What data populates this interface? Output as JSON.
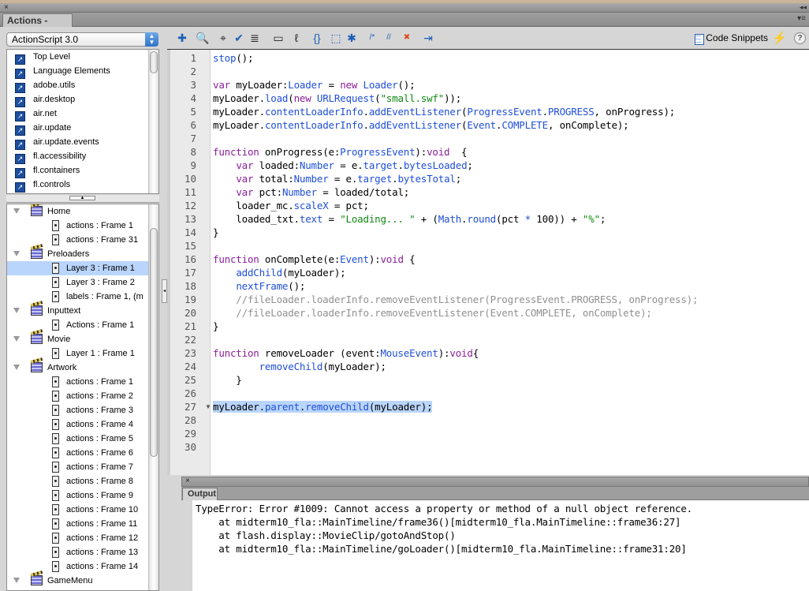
{
  "window": {
    "close": "×",
    "collapse": "◂◂",
    "panel_menu": "▾≡",
    "tab": "Actions - Frame"
  },
  "language_select": {
    "value": "ActionScript 3.0"
  },
  "library": {
    "items": [
      "Top Level",
      "Language Elements",
      "adobe.utils",
      "air.desktop",
      "air.net",
      "air.update",
      "air.update.events",
      "fl.accessibility",
      "fl.containers",
      "fl.controls"
    ]
  },
  "tree": {
    "rows": [
      {
        "type": "group",
        "label": "Home"
      },
      {
        "type": "frame",
        "label": "actions : Frame 1"
      },
      {
        "type": "frame",
        "label": "actions : Frame 31"
      },
      {
        "type": "group",
        "label": "Preloaders"
      },
      {
        "type": "frame",
        "label": "Layer 3 : Frame 1",
        "selected": true
      },
      {
        "type": "frame",
        "label": "Layer 3 : Frame 2"
      },
      {
        "type": "frame",
        "label": "labels : Frame 1, (m"
      },
      {
        "type": "group",
        "label": "Inputtext"
      },
      {
        "type": "frame",
        "label": "Actions : Frame 1"
      },
      {
        "type": "group",
        "label": "Movie"
      },
      {
        "type": "frame",
        "label": "Layer 1 : Frame 1"
      },
      {
        "type": "group",
        "label": "Artwork"
      },
      {
        "type": "frame",
        "label": "actions : Frame 1"
      },
      {
        "type": "frame",
        "label": "actions : Frame 2"
      },
      {
        "type": "frame",
        "label": "actions : Frame 3"
      },
      {
        "type": "frame",
        "label": "actions : Frame 4"
      },
      {
        "type": "frame",
        "label": "actions : Frame 5"
      },
      {
        "type": "frame",
        "label": "actions : Frame 6"
      },
      {
        "type": "frame",
        "label": "actions : Frame 7"
      },
      {
        "type": "frame",
        "label": "actions : Frame 8"
      },
      {
        "type": "frame",
        "label": "actions : Frame 9"
      },
      {
        "type": "frame",
        "label": "actions : Frame 10"
      },
      {
        "type": "frame",
        "label": "actions : Frame 11"
      },
      {
        "type": "frame",
        "label": "actions : Frame 12"
      },
      {
        "type": "frame",
        "label": "actions : Frame 13"
      },
      {
        "type": "frame",
        "label": "actions : Frame 14"
      },
      {
        "type": "group",
        "label": "GameMenu"
      }
    ]
  },
  "toolbar": {
    "icons": [
      {
        "name": "add-statement-icon",
        "glyph": "✚"
      },
      {
        "name": "find-icon",
        "glyph": "🔍"
      },
      {
        "name": "target-path-icon",
        "glyph": "⌖"
      },
      {
        "name": "check-syntax-icon",
        "glyph": "✔"
      },
      {
        "name": "auto-format-icon",
        "glyph": "≣"
      },
      {
        "name": "code-hint-icon",
        "glyph": "▭"
      },
      {
        "name": "debug-options-icon",
        "glyph": "ℓ"
      },
      {
        "name": "collapse-braces-icon",
        "glyph": "{}"
      },
      {
        "name": "collapse-selection-icon",
        "glyph": "⬚"
      },
      {
        "name": "expand-all-icon",
        "glyph": "✱"
      },
      {
        "name": "block-comment-icon",
        "glyph": "/*"
      },
      {
        "name": "line-comment-icon",
        "glyph": "//"
      },
      {
        "name": "remove-comment-icon",
        "glyph": "✖"
      },
      {
        "name": "show-hide-toolbox-icon",
        "glyph": "⇥"
      }
    ],
    "code_snippets": "Code Snippets",
    "wand": "⚡",
    "help": "?"
  },
  "code": {
    "selected_line": 27,
    "lines": [
      [
        [
          "stop",
          "ty"
        ],
        [
          "();",
          "pl"
        ]
      ],
      [],
      [
        [
          "var",
          "kw"
        ],
        [
          " myLoader:",
          "pl"
        ],
        [
          "Loader",
          "ty"
        ],
        [
          " = ",
          "pl"
        ],
        [
          "new",
          "kw"
        ],
        [
          " ",
          "pl"
        ],
        [
          "Loader",
          "ty"
        ],
        [
          "();",
          "pl"
        ]
      ],
      [
        [
          "myLoader.",
          "pl"
        ],
        [
          "load",
          "ty"
        ],
        [
          "(",
          "pl"
        ],
        [
          "new",
          "kw"
        ],
        [
          " ",
          "pl"
        ],
        [
          "URLRequest",
          "ty"
        ],
        [
          "(",
          "pl"
        ],
        [
          "\"small.swf\"",
          "str"
        ],
        [
          "));",
          "pl"
        ]
      ],
      [
        [
          "myLoader.",
          "pl"
        ],
        [
          "contentLoaderInfo",
          "ty"
        ],
        [
          ".",
          "pl"
        ],
        [
          "addEventListener",
          "ty"
        ],
        [
          "(",
          "pl"
        ],
        [
          "ProgressEvent",
          "ty"
        ],
        [
          ".",
          "pl"
        ],
        [
          "PROGRESS",
          "ty"
        ],
        [
          ", onProgress);",
          "pl"
        ]
      ],
      [
        [
          "myLoader.",
          "pl"
        ],
        [
          "contentLoaderInfo",
          "ty"
        ],
        [
          ".",
          "pl"
        ],
        [
          "addEventListener",
          "ty"
        ],
        [
          "(",
          "pl"
        ],
        [
          "Event",
          "ty"
        ],
        [
          ".",
          "pl"
        ],
        [
          "COMPLETE",
          "ty"
        ],
        [
          ", onComplete);",
          "pl"
        ]
      ],
      [],
      [
        [
          "function",
          "kw"
        ],
        [
          " onProgress(e:",
          "pl"
        ],
        [
          "ProgressEvent",
          "ty"
        ],
        [
          "):",
          "pl"
        ],
        [
          "void",
          "kw"
        ],
        [
          "  {",
          "pl"
        ]
      ],
      [
        [
          "    ",
          "pl"
        ],
        [
          "var",
          "kw"
        ],
        [
          " loaded:",
          "pl"
        ],
        [
          "Number",
          "ty"
        ],
        [
          " = e.",
          "pl"
        ],
        [
          "target",
          "ty"
        ],
        [
          ".",
          "pl"
        ],
        [
          "bytesLoaded",
          "ty"
        ],
        [
          ";",
          "pl"
        ]
      ],
      [
        [
          "    ",
          "pl"
        ],
        [
          "var",
          "kw"
        ],
        [
          " total:",
          "pl"
        ],
        [
          "Number",
          "ty"
        ],
        [
          " = e.",
          "pl"
        ],
        [
          "target",
          "ty"
        ],
        [
          ".",
          "pl"
        ],
        [
          "bytesTotal",
          "ty"
        ],
        [
          ";",
          "pl"
        ]
      ],
      [
        [
          "    ",
          "pl"
        ],
        [
          "var",
          "kw"
        ],
        [
          " pct:",
          "pl"
        ],
        [
          "Number",
          "ty"
        ],
        [
          " = loaded/total;",
          "pl"
        ]
      ],
      [
        [
          "    loader_mc.",
          "pl"
        ],
        [
          "scaleX",
          "ty"
        ],
        [
          " = pct;",
          "pl"
        ]
      ],
      [
        [
          "    loaded_txt.",
          "pl"
        ],
        [
          "text",
          "ty"
        ],
        [
          " = ",
          "pl"
        ],
        [
          "\"Loading... \"",
          "str"
        ],
        [
          " + (",
          "pl"
        ],
        [
          "Math",
          "ty"
        ],
        [
          ".",
          "pl"
        ],
        [
          "round",
          "ty"
        ],
        [
          "(pct ",
          "pl"
        ],
        [
          "*",
          "ty"
        ],
        [
          " 100)) + ",
          "pl"
        ],
        [
          "\"%\"",
          "str"
        ],
        [
          ";",
          "pl"
        ]
      ],
      [
        [
          "}",
          "pl"
        ]
      ],
      [],
      [
        [
          "function",
          "kw"
        ],
        [
          " onComplete(e:",
          "pl"
        ],
        [
          "Event",
          "ty"
        ],
        [
          "):",
          "pl"
        ],
        [
          "void",
          "kw"
        ],
        [
          " {",
          "pl"
        ]
      ],
      [
        [
          "    ",
          "pl"
        ],
        [
          "addChild",
          "ty"
        ],
        [
          "(myLoader);",
          "pl"
        ]
      ],
      [
        [
          "    ",
          "pl"
        ],
        [
          "nextFrame",
          "ty"
        ],
        [
          "();",
          "pl"
        ]
      ],
      [
        [
          "    //fileLoader.loaderInfo.removeEventListener(ProgressEvent.PROGRESS, onProgress);",
          "cmt"
        ]
      ],
      [
        [
          "    //fileLoader.loaderInfo.removeEventListener(Event.COMPLETE, onComplete);",
          "cmt"
        ]
      ],
      [
        [
          "}",
          "pl"
        ]
      ],
      [],
      [
        [
          "function",
          "kw"
        ],
        [
          " removeLoader (event:",
          "pl"
        ],
        [
          "MouseEvent",
          "ty"
        ],
        [
          "):",
          "pl"
        ],
        [
          "void",
          "kw"
        ],
        [
          "{",
          "pl"
        ]
      ],
      [
        [
          "        ",
          "pl"
        ],
        [
          "removeChild",
          "ty"
        ],
        [
          "(myLoader);",
          "pl"
        ]
      ],
      [
        [
          "    }",
          "pl"
        ]
      ],
      [],
      [
        [
          "myLoader.",
          "pl"
        ],
        [
          "parent",
          "ty"
        ],
        [
          ".",
          "pl"
        ],
        [
          "removeChild",
          "ty"
        ],
        [
          "(myLoader);",
          "pl"
        ]
      ],
      [],
      [],
      []
    ]
  },
  "output": {
    "close": "×",
    "tab": "Output",
    "lines": [
      "TypeError: Error #1009: Cannot access a property or method of a null object reference.",
      "    at midterm10_fla::MainTimeline/frame36()[midterm10_fla.MainTimeline::frame36:27]",
      "    at flash.display::MovieClip/gotoAndStop()",
      "    at midterm10_fla::MainTimeline/goLoader()[midterm10_fla.MainTimeline::frame31:20]"
    ]
  }
}
